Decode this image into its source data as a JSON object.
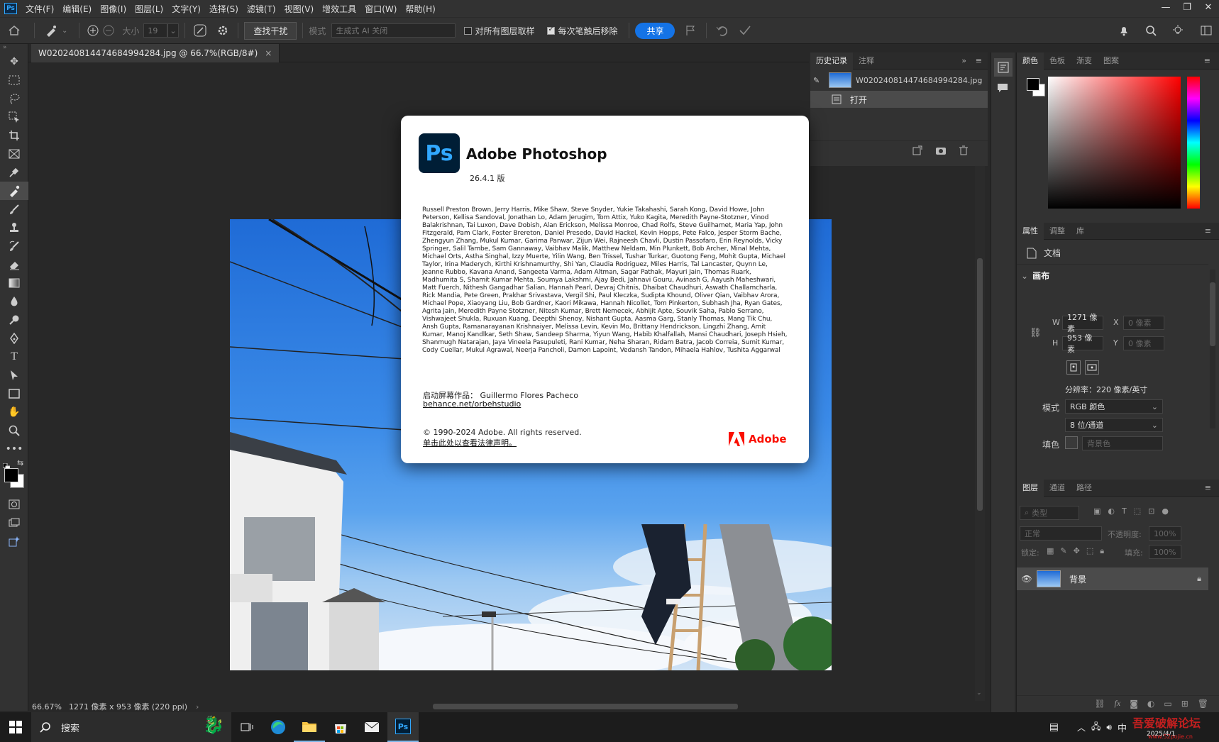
{
  "app": {
    "logo": "Ps"
  },
  "menu": [
    "文件(F)",
    "编辑(E)",
    "图像(I)",
    "图层(L)",
    "文字(Y)",
    "选择(S)",
    "滤镜(T)",
    "视图(V)",
    "增效工具",
    "窗口(W)",
    "帮助(H)"
  ],
  "window_controls": {
    "minimize": "—",
    "restore": "❐",
    "close": "✕"
  },
  "options_bar": {
    "size_label": "大小",
    "size_value": "19",
    "find_distract": "查找干扰",
    "mode_label": "模式",
    "mode_value": "生成式 AI 关闭",
    "sample_all_layers": "对所有图层取样",
    "remove_after_stroke": "每次笔触后移除",
    "share": "共享"
  },
  "document_tab": {
    "title": "W020240814474684994284.jpg @ 66.7%(RGB/8#)",
    "close": "×"
  },
  "status": {
    "zoom": "66.67%",
    "info": "1271 像素 x 953 像素 (220 ppi)",
    "arrow": "›"
  },
  "history_panel": {
    "tabs": [
      "历史记录",
      "注释"
    ],
    "snapshot_name": "W020240814474684994284.jpg",
    "steps": [
      "打开"
    ]
  },
  "color_panel": {
    "tabs": [
      "颜色",
      "色板",
      "渐变",
      "图案"
    ]
  },
  "properties_panel": {
    "tabs": [
      "属性",
      "调整",
      "库"
    ],
    "doc_label": "文档",
    "canvas_label": "画布",
    "w_label": "W",
    "w_value": "1271 像素",
    "h_label": "H",
    "h_value": "953 像素",
    "x_label": "X",
    "x_placeholder": "0 像素",
    "y_label": "Y",
    "y_placeholder": "0 像素",
    "resolution": "分辨率：220 像素/英寸",
    "mode_label": "模式",
    "mode_value": "RGB 颜色",
    "depth_value": "8 位/通道",
    "fill_label": "填色",
    "fill_value": "背景色"
  },
  "layers_panel": {
    "tabs": [
      "图层",
      "通道",
      "路径"
    ],
    "filter_placeholder": "类型",
    "blend_mode": "正常",
    "opacity_label": "不透明度:",
    "opacity_value": "100%",
    "lock_label": "锁定:",
    "fill_label": "填充:",
    "fill_value": "100%",
    "layer_name": "背景"
  },
  "about_dialog": {
    "logo": "Ps",
    "title": "Adobe Photoshop",
    "version": "26.4.1 版",
    "credits": "Russell Preston Brown, Jerry Harris, Mike Shaw, Steve Snyder, Yukie Takahashi, Sarah Kong, David Howe, John Peterson, Kellisa Sandoval, Jonathan Lo, Adam Jerugim, Tom Attix, Yuko Kagita, Meredith Payne-Stotzner, Vinod Balakrishnan, Tai Luxon, Dave Dobish, Alan Erickson, Melissa Monroe, Chad Rolfs, Steve Guilhamet, Maria Yap, John Fitzgerald, Pam Clark, Foster Brereton, Daniel Presedo, David Hackel, Kevin Hopps, Pete Falco, Jesper Storm Bache, Zhengyun Zhang, Mukul Kumar, Garima Panwar, Zijun Wei, Rajneesh Chavli, Dustin Passofaro, Erin Reynolds, Vicky Springer, Salil Tambe, Sam Gannaway, Vaibhav Malik, Matthew Neldam, Min Plunkett, Bob Archer, Minal Mehta, Michael Orts, Astha Singhal, Izzy Muerte, Yilin Wang, Ben Trissel, Tushar Turkar, Guotong Feng, Mohit Gupta, Michael Taylor, Irina Maderych, Kirthi Krishnamurthy, Shi Yan, Claudia Rodriguez, Miles Harris, Tal Lancaster, Quynn Le, Jeanne Rubbo, Kavana Anand, Sangeeta Varma, Adam Altman, Sagar Pathak, Mayuri Jain, Thomas Ruark, Madhumita S, Shamit Kumar Mehta, Soumya Lakshmi, Ajay Bedi, Jahnavi Gouru, Avinash G, Aayush Maheshwari, Matt Fuerch, Nithesh Gangadhar Salian, Hannah Pearl, Devraj Chitnis, Dhaibat Chaudhuri, Aswath Challamcharla, Rick Mandia, Pete Green, Prakhar Srivastava, Vergil Shi, Paul Kleczka, Sudipta Khound, Oliver Qian, Vaibhav Arora, Michael Pope, Xiaoyang Liu, Bob Gardner, Kaori Mikawa, Hannah Nicollet, Tom Pinkerton, Subhash Jha, Ryan Gates, Agrita Jain, Meredith Payne Stotzner, Nitesh Kumar, Brett Nemecek, Abhijit Apte, Souvik Saha, Pablo Serrano, Vishwajeet Shukla, Ruxuan Kuang, Deepthi Shenoy, Nishant Gupta, Aasma Garg, Stanly Thomas, Mang Tik Chu, Ansh Gupta, Ramanarayanan Krishnaiyer, Melissa Levin, Kevin Mo, Brittany Hendrickson, Lingzhi Zhang, Amit Kumar, Manoj Kandlkar, Seth Shaw, Sandeep Sharma, Yiyun Wang, Habib Khalfallah, Mansi Chaudhari, Joseph Hsieh, Shanmugh Natarajan, Jaya Vineela Pasupuleti, Rani Kumar, Neha Sharan, Ridam Batra, Jacob Correia, Sumit Kumar, Cody Cuellar, Mukul Agrawal, Neerja Pancholi, Damon Lapoint, Vedansh Tandon, Mihaela Hahlov, Tushita Aggarwal",
    "splash_label": "启动屏幕作品：",
    "splash_artist": "Guillermo Flores Pacheco",
    "splash_link": "behance.net/orbehstudio",
    "copyright": "© 1990-2024 Adobe. All rights reserved.",
    "legal_link": "单击此处以查看法律声明。",
    "adobe_word": "Adobe"
  },
  "taskbar": {
    "search": "搜索",
    "ime": "中",
    "date": "2025/4/1",
    "watermark": "吾爱破解论坛",
    "watermark_url": "www.52pojie.cn"
  }
}
